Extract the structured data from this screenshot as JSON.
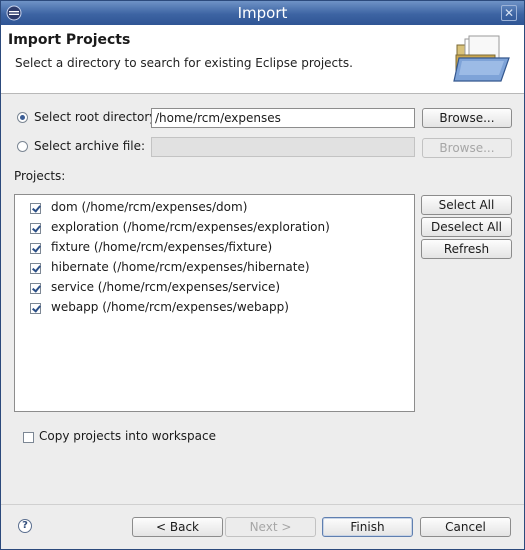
{
  "window": {
    "title": "Import",
    "app_icon": "eclipse-icon",
    "close_label": "✕"
  },
  "header": {
    "title": "Import Projects",
    "description": "Select a directory to search for existing Eclipse projects.",
    "icon": "open-folder-icon"
  },
  "source": {
    "root_directory_label": "Select root directory:",
    "root_directory_value": "/home/rcm/expenses",
    "root_directory_selected": true,
    "archive_label": "Select archive file:",
    "archive_value": "",
    "archive_selected": false,
    "browse_label": "Browse...",
    "browse_disabled_label": "Browse..."
  },
  "projects": {
    "label": "Projects:",
    "items": [
      {
        "label": "dom (/home/rcm/expenses/dom)",
        "checked": true
      },
      {
        "label": "exploration (/home/rcm/expenses/exploration)",
        "checked": true
      },
      {
        "label": "fixture (/home/rcm/expenses/fixture)",
        "checked": true
      },
      {
        "label": "hibernate (/home/rcm/expenses/hibernate)",
        "checked": true
      },
      {
        "label": "service (/home/rcm/expenses/service)",
        "checked": true
      },
      {
        "label": "webapp (/home/rcm/expenses/webapp)",
        "checked": true
      }
    ],
    "select_all_label": "Select All",
    "deselect_all_label": "Deselect All",
    "refresh_label": "Refresh"
  },
  "options": {
    "copy_label": "Copy projects into workspace",
    "copy_checked": false
  },
  "footer": {
    "back_label": "< Back",
    "next_label": "Next >",
    "finish_label": "Finish",
    "cancel_label": "Cancel",
    "help_label": "?"
  },
  "colors": {
    "titlebar": "#3d64a3",
    "accent": "#3b5d95"
  }
}
